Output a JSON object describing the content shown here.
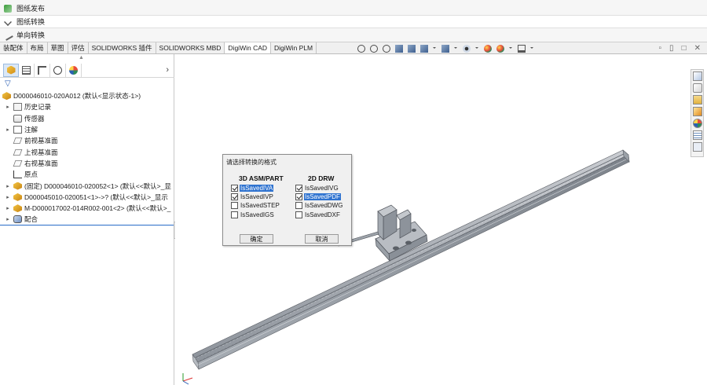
{
  "quick": {
    "row1": "图纸发布",
    "row2": "图纸转换",
    "row3": "单向转换"
  },
  "tabs": [
    {
      "label": "装配体"
    },
    {
      "label": "布局"
    },
    {
      "label": "草图"
    },
    {
      "label": "评估"
    },
    {
      "label": "SOLIDWORKS 插件"
    },
    {
      "label": "SOLIDWORKS MBD"
    },
    {
      "label": "DigiWin CAD"
    },
    {
      "label": "DigiWin PLM"
    }
  ],
  "active_tab": "DigiWin CAD",
  "tree": {
    "root": "D000046010-020A012  (默认<显示状态-1>)",
    "items": [
      {
        "label": "历史记录",
        "icon": "history-icon"
      },
      {
        "label": "传感器",
        "icon": "sensor-icon"
      },
      {
        "label": "注解",
        "icon": "annotation-icon"
      },
      {
        "label": "前视基准面",
        "icon": "plane-icon"
      },
      {
        "label": "上视基准面",
        "icon": "plane-icon"
      },
      {
        "label": "右视基准面",
        "icon": "plane-icon"
      },
      {
        "label": "原点",
        "icon": "origin-icon"
      },
      {
        "label": "(固定) D000046010-020052<1> (默认<<默认>_显",
        "icon": "part-icon"
      },
      {
        "label": "D000045010-020051<1>->? (默认<<默认>_显示",
        "icon": "part-icon"
      },
      {
        "label": "M-D000017002-014R002-001<2> (默认<<默认>_",
        "icon": "part-icon"
      },
      {
        "label": "配合",
        "icon": "mates-icon"
      }
    ]
  },
  "dialog": {
    "title": "请选择转换的格式",
    "left_head": "3D ASM/PART",
    "right_head": "2D DRW",
    "left_opts": [
      {
        "label": "IsSavedIVA",
        "checked": true,
        "highlight": true
      },
      {
        "label": "IsSavedIVP",
        "checked": true,
        "highlight": false
      },
      {
        "label": "IsSavedSTEP",
        "checked": false,
        "highlight": false
      },
      {
        "label": "IsSavedIGS",
        "checked": false,
        "highlight": false
      }
    ],
    "right_opts": [
      {
        "label": "IsSavedIVG",
        "checked": true,
        "highlight": false
      },
      {
        "label": "IsSavedPDF",
        "checked": true,
        "highlight": true
      },
      {
        "label": "IsSavedDWG",
        "checked": false,
        "highlight": false
      },
      {
        "label": "IsSavedDXF",
        "checked": false,
        "highlight": false
      }
    ],
    "ok_label": "确定",
    "cancel_label": "取消"
  },
  "colors": {
    "selection_blue": "#2f73d0",
    "part_gray": "#8d939b"
  }
}
